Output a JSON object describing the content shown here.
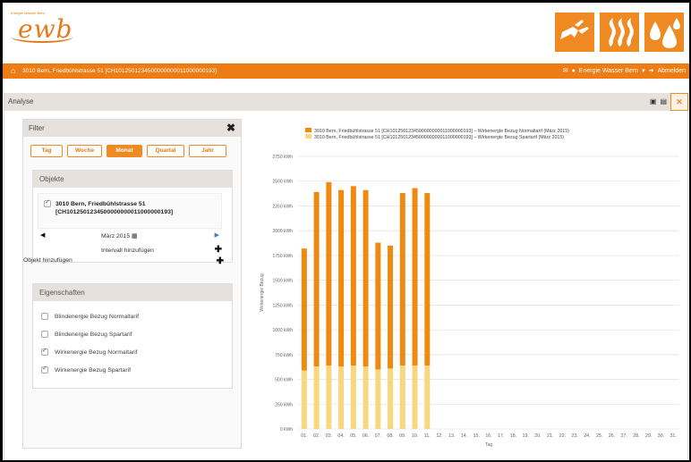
{
  "header": {
    "logo_small": "Energie Wasser Bern",
    "logo_word": "ewb",
    "tiles": [
      "plug-icon",
      "heat-icon",
      "water-drops-icon"
    ]
  },
  "navbar": {
    "address": "3010 Bern, Friedbühlstrasse 51 [CH1012501234500000000011000000193]",
    "user": "Energie Wasser Bern",
    "logout": "Abmelden"
  },
  "analyse": {
    "title": "Analyse"
  },
  "filter": {
    "title": "Filter",
    "buttons": [
      "Tag",
      "Woche",
      "Monat",
      "Quartal",
      "Jahr"
    ],
    "active_button": "Monat",
    "objekte": {
      "title": "Objekte",
      "object_line1": "3010 Bern, Friedbühlstrasse 51",
      "object_line2": "[CH1012501234500000000011000000193]",
      "month": "März 2015",
      "interval_add": "Intervall hinzufügen"
    },
    "objekt_add": "Objekt hinzufügen",
    "eigenschaften": {
      "title": "Eigenschaften",
      "items": [
        {
          "label": "Blindenergie Bezug Normaltarif",
          "checked": false
        },
        {
          "label": "Blindenergie Bezug Spartarif",
          "checked": false
        },
        {
          "label": "Wirkenergie Bezug Normaltarif",
          "checked": true
        },
        {
          "label": "Wirkenergie Bezug Spartarif",
          "checked": true
        }
      ]
    }
  },
  "chart_data": {
    "type": "bar",
    "stacked": true,
    "xlabel": "Tag",
    "ylabel": "Wirkenergie Bezug",
    "ylim": [
      0,
      2750
    ],
    "yticks": [
      "0 kWh",
      "250 kWh",
      "500 kWh",
      "750 kWh",
      "1000 kWh",
      "1250 kWh",
      "1500 kWh",
      "1750 kWh",
      "2000 kWh",
      "2250 kWh",
      "2500 kWh",
      "2750 kWh"
    ],
    "categories": [
      "01.",
      "02.",
      "03.",
      "04.",
      "05.",
      "06.",
      "07.",
      "08.",
      "09.",
      "10.",
      "11.",
      "12.",
      "13.",
      "14.",
      "15.",
      "16.",
      "17.",
      "18.",
      "19.",
      "20.",
      "21.",
      "22.",
      "23.",
      "24.",
      "25.",
      "26.",
      "27.",
      "28.",
      "29.",
      "30.",
      "31."
    ],
    "series": [
      {
        "name": "3010 Bern, Friedbühlstrasse 51 [CH1012501234500000000011000000193] – Wirkenergie Bezug Spartarif (März 2015)",
        "color": "#f9d77e",
        "values": [
          590,
          630,
          640,
          630,
          640,
          630,
          600,
          610,
          640,
          640,
          640,
          null,
          null,
          null,
          null,
          null,
          null,
          null,
          null,
          null,
          null,
          null,
          null,
          null,
          null,
          null,
          null,
          null,
          null,
          null,
          null
        ]
      },
      {
        "name": "3010 Bern, Friedbühlstrasse 51 [CH1012501234500000000011000000193] – Wirkenergie Bezug Normaltarif (März 2015)",
        "color": "#ef8a10",
        "values": [
          1230,
          1760,
          1850,
          1780,
          1810,
          1780,
          1280,
          1240,
          1740,
          1790,
          1740,
          null,
          null,
          null,
          null,
          null,
          null,
          null,
          null,
          null,
          null,
          null,
          null,
          null,
          null,
          null,
          null,
          null,
          null,
          null,
          null
        ]
      }
    ],
    "legend": [
      {
        "name": "3010 Bern, Friedbühlstrasse 51 [CH1012501234500000000011000000193] – Wirkenergie Bezug Normaltarif (März 2015)",
        "color": "#ef8a10"
      },
      {
        "name": "3010 Bern, Friedbühlstrasse 51 [CH1012501234500000000011000000193] – Wirkenergie Bezug Spartarif (März 2015)",
        "color": "#f9d77e"
      }
    ],
    "legend_position": "top-left",
    "grid": true
  }
}
